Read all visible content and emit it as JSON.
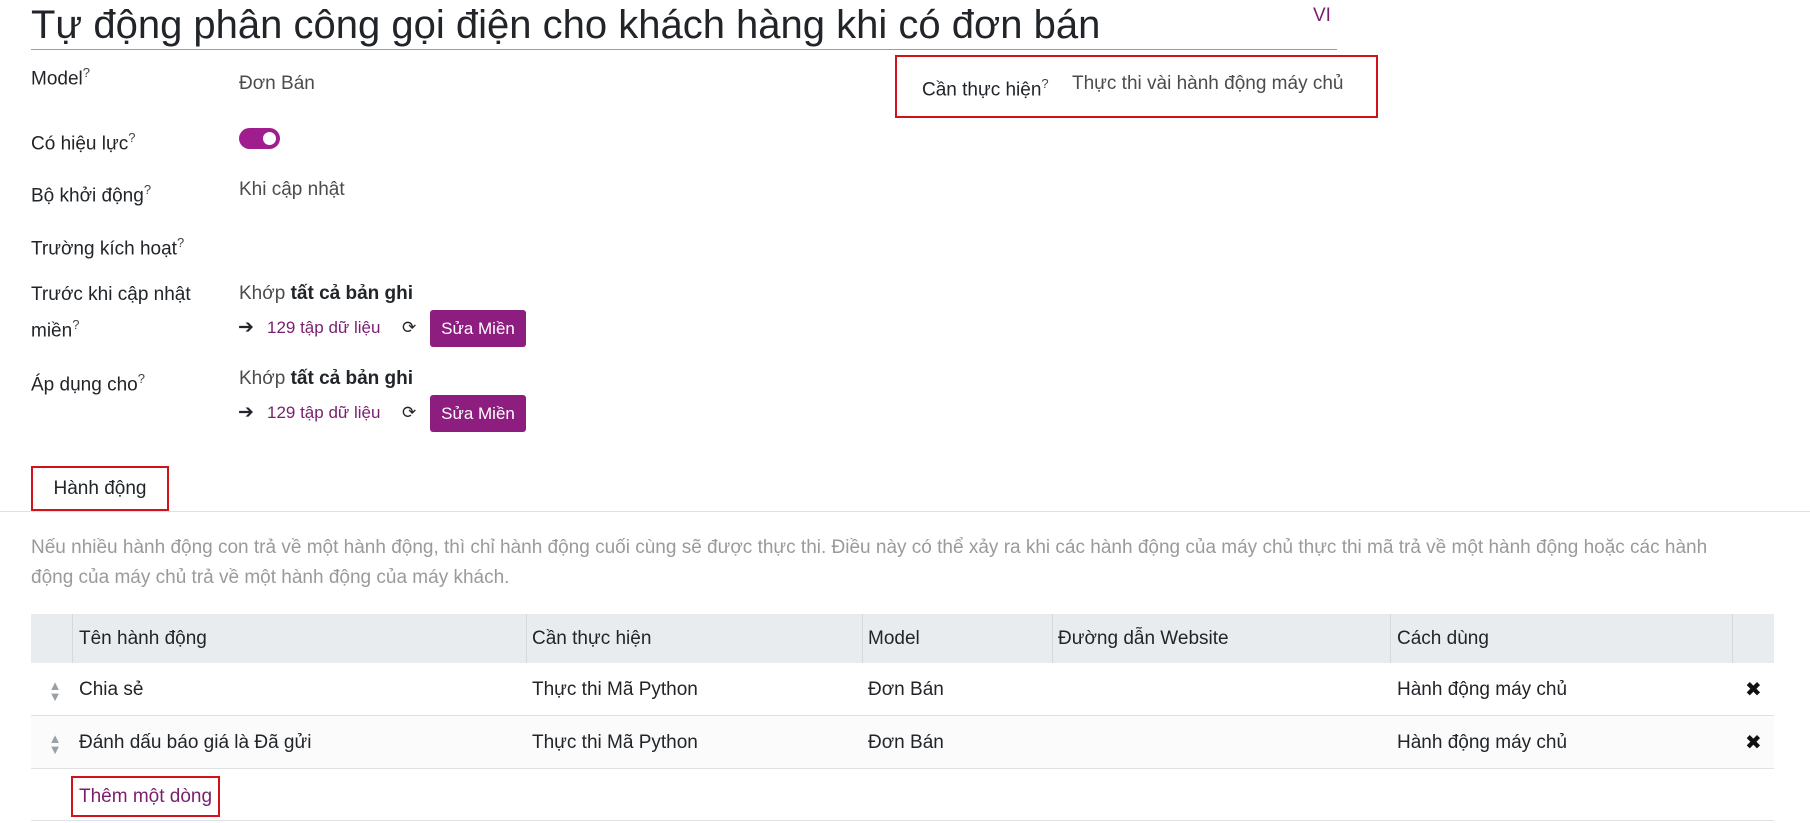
{
  "page": {
    "title": "Tự động phân công gọi điện cho khách hàng khi có đơn bán",
    "language": "VI"
  },
  "fields": {
    "model": {
      "label": "Model",
      "help": "?",
      "value": "Đơn Bán"
    },
    "active": {
      "label": "Có hiệu lực",
      "help": "?",
      "value": true
    },
    "trigger": {
      "label": "Bộ khởi động",
      "help": "?",
      "value": "Khi cập nhật"
    },
    "trigger_fields": {
      "label": "Trường kích hoạt",
      "help": "?",
      "value": ""
    },
    "before_domain": {
      "label_line1": "Trước khi cập nhật",
      "label_line2": "miền",
      "help": "?",
      "match_prefix": "Khớp",
      "match_bold": "tất cả bản ghi",
      "records": "129 tập dữ liệu",
      "edit_button": "Sửa Miền"
    },
    "apply_on": {
      "label": "Áp dụng cho",
      "help": "?",
      "match_prefix": "Khớp",
      "match_bold": "tất cả bản ghi",
      "records": "129 tập dữ liệu",
      "edit_button": "Sửa Miền"
    },
    "action_to_do": {
      "label": "Cần thực hiện",
      "help": "?",
      "value": "Thực thi vài hành động máy chủ"
    }
  },
  "tabs": [
    {
      "label": "Hành động",
      "active": true
    }
  ],
  "actions_note": "Nếu nhiều hành động con trả về một hành động, thì chỉ hành động cuối cùng sẽ được thực thi. Điều này có thể xảy ra khi các hành động của máy chủ thực thi mã trả về một hành động hoặc các hành động của máy chủ trả về một hành động của máy khách.",
  "table": {
    "columns": [
      "Tên hành động",
      "Cần thực hiện",
      "Model",
      "Đường dẫn Website",
      "Cách dùng"
    ],
    "rows": [
      {
        "name": "Chia sẻ",
        "action": "Thực thi Mã Python",
        "model": "Đơn Bán",
        "website_path": "",
        "usage": "Hành động máy chủ"
      },
      {
        "name": "Đánh dấu báo giá là Đã gửi",
        "action": "Thực thi Mã Python",
        "model": "Đơn Bán",
        "website_path": "",
        "usage": "Hành động máy chủ"
      }
    ],
    "add_line": "Thêm một dòng"
  },
  "icons": {
    "arrow": "arrow-right-icon",
    "refresh": "refresh-icon",
    "drag": "drag-handle-icon",
    "delete": "delete-x-icon"
  },
  "colors": {
    "accent": "#8d1d7f",
    "link": "#7a1f6e",
    "highlight_box": "#d0121b",
    "title_underline": "#5cb6c1"
  }
}
